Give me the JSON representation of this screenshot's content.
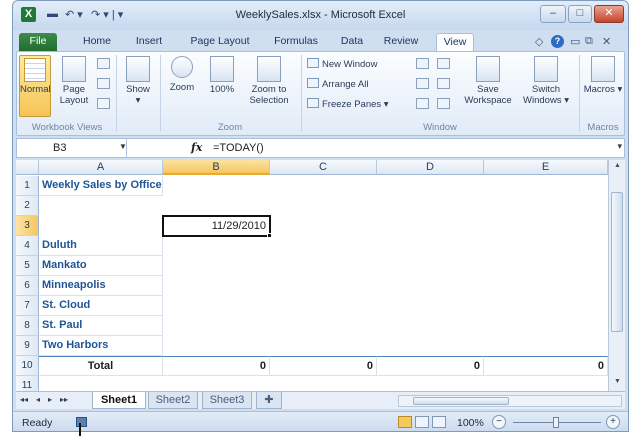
{
  "window": {
    "title": "WeeklySales.xlsx - Microsoft Excel",
    "logo": "X",
    "controls": {
      "minimize": "–",
      "maximize": "□",
      "close": "✕"
    }
  },
  "quick_access": {
    "save_icon": "save-icon",
    "undo": "↶ ▾",
    "redo": "↷ ▾ | ▾"
  },
  "tabs": [
    "File",
    "Home",
    "Insert",
    "Page Layout",
    "Formulas",
    "Data",
    "Review",
    "View"
  ],
  "active_tab": "View",
  "tab_icons": {
    "dropdown": "◇",
    "help": "?",
    "restore": "▭",
    "restore2": "⧉",
    "close": "✕"
  },
  "ribbon": {
    "workbook_views": {
      "label": "Workbook Views",
      "normal": "Normal",
      "page_layout": "Page Layout"
    },
    "show": {
      "label": "Show",
      "arrow": "▾"
    },
    "zoom": {
      "label": "Zoom",
      "zoom": "Zoom",
      "pct100": "100%",
      "zoom_to_selection": "Zoom to Selection"
    },
    "window": {
      "label": "Window",
      "new_window": "New Window",
      "arrange_all": "Arrange All",
      "freeze_panes": "Freeze Panes ▾",
      "save_workspace": "Save Workspace",
      "switch_windows": "Switch Windows ▾"
    },
    "macros": {
      "label": "Macros",
      "macros": "Macros ▾"
    }
  },
  "formula_bar": {
    "name_box": "B3",
    "fx": "fx",
    "formula": "=TODAY()",
    "expand": "▾"
  },
  "columns": [
    "A",
    "B",
    "C",
    "D",
    "E"
  ],
  "selected_column": "B",
  "rows": [
    "1",
    "2",
    "3",
    "4",
    "5",
    "6",
    "7",
    "8",
    "9",
    "10",
    "11"
  ],
  "selected_row": "3",
  "cells": {
    "A1": "Weekly Sales by Office",
    "B3": "11/29/2010",
    "A4": "Duluth",
    "A5": "Mankato",
    "A6": "Minneapolis",
    "A7": "St. Cloud",
    "A8": "St. Paul",
    "A9": "Two Harbors",
    "A10": "Total",
    "B10": "0",
    "C10": "0",
    "D10": "0",
    "E10": "0"
  },
  "sheets": [
    "Sheet1",
    "Sheet2",
    "Sheet3"
  ],
  "active_sheet": "Sheet1",
  "sheet_nav": [
    "◂◂",
    "◂",
    "▸",
    "▸▸"
  ],
  "status": {
    "ready": "Ready",
    "zoom": "100%",
    "zoom_out": "−",
    "zoom_in": "+"
  }
}
